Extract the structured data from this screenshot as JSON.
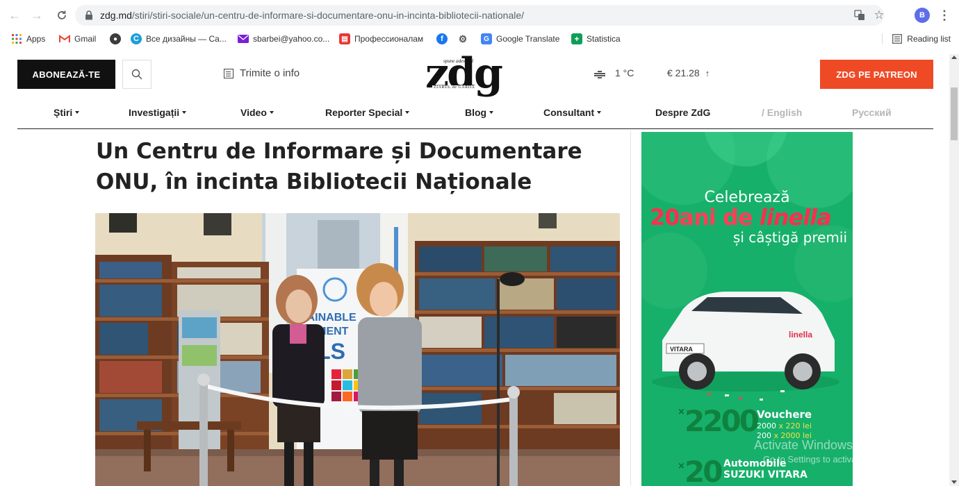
{
  "browser": {
    "url_domain": "zdg.md",
    "url_path": "/stiri/stiri-sociale/un-centru-de-informare-si-documentare-onu-in-incinta-bibliotecii-nationale/",
    "profile_initial": "B",
    "reading_list_label": "Reading list",
    "bookmarks": [
      {
        "label": "Apps"
      },
      {
        "label": "Gmail"
      },
      {
        "label": ""
      },
      {
        "label": "Все дизайны — Ca..."
      },
      {
        "label": "sbarbei@yahoo.co..."
      },
      {
        "label": "Профессионалам"
      },
      {
        "label": ""
      },
      {
        "label": ""
      },
      {
        "label": "Google Translate"
      },
      {
        "label": "Statistica"
      }
    ]
  },
  "header": {
    "subscribe_label": "ABONEAZĂ-TE",
    "tip_label": "Trimite o info",
    "logo_text": "zdg",
    "logo_tagline": "spune adevărul",
    "logo_sub": "ZIARUL de GARDĂ",
    "temperature": "1 °C",
    "currency": "€ 21.28",
    "currency_trend": "↑",
    "patreon_label": "ZDG PE PATREON"
  },
  "nav": [
    {
      "label": "Știri",
      "dropdown": true
    },
    {
      "label": "Investigații",
      "dropdown": true
    },
    {
      "label": "Video",
      "dropdown": true
    },
    {
      "label": "Reporter Special",
      "dropdown": true
    },
    {
      "label": "Blog",
      "dropdown": true
    },
    {
      "label": "Consultant",
      "dropdown": true
    },
    {
      "label": "Despre ZdG",
      "dropdown": false
    },
    {
      "label": "/ English",
      "dropdown": false
    },
    {
      "label": "Русский",
      "dropdown": false
    }
  ],
  "article": {
    "title_line1": "Un Centru de Informare și Documentare",
    "title_line2": "ONU, în incinta Bibliotecii Naționale",
    "photo_banner_text": [
      "TAINABLE",
      "OPMENT",
      "ALS"
    ]
  },
  "ad": {
    "line1": "Celebrează",
    "line2_a": "20",
    "line2_b": "ani de ",
    "line2_c": "linella",
    "line3": "și câștigă premii",
    "car_plate": "VITARA",
    "car_brand_badge": "linella",
    "voucher_mult": "×",
    "voucher_count": "2200",
    "voucher_label": "Vouchere",
    "voucher_detail1_a": "2000",
    "voucher_detail1_b": " x 220 lei",
    "voucher_detail2_a": "200",
    "voucher_detail2_b": " x 2000 lei",
    "car_mult": "×",
    "car_count": "20",
    "car_label": "Automobile",
    "car_model": "SUZUKI VITARA"
  },
  "os": {
    "watermark_title": "Activate Windows",
    "watermark_sub": "Go to Settings to activate Windows."
  },
  "colors": {
    "patreon": "#ef4a26",
    "ad_green": "#16b06a",
    "linella_red": "#ff2e4e"
  }
}
